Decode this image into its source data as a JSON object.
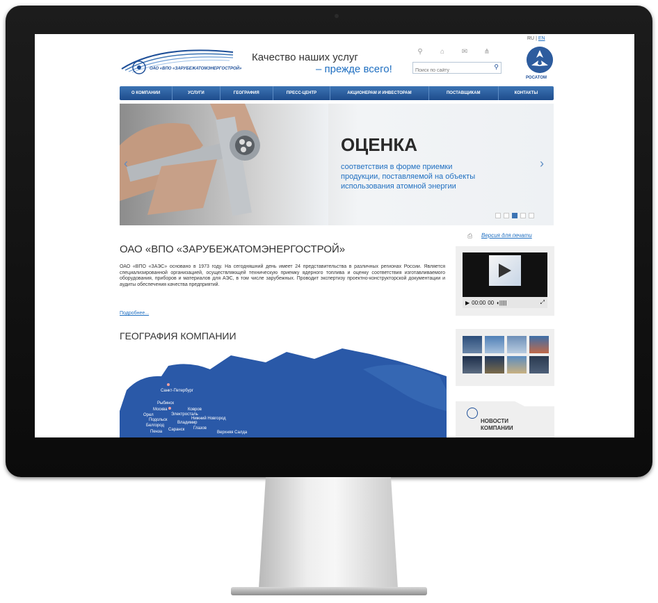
{
  "header": {
    "logo_text": "ОАО «ВПО «ЗАРУБЕЖАТОМЭНЕРГОСТРОЙ»",
    "slogan_line1": "Качество наших услуг",
    "slogan_line2": "– прежде всего!",
    "search_placeholder": "Поиск по сайту",
    "lang_ru": "RU",
    "lang_sep": " | ",
    "lang_en": "EN",
    "partner_logo_text": "РОСАТОМ",
    "icons": [
      "key-icon",
      "home-icon",
      "mail-icon",
      "sitemap-icon"
    ]
  },
  "nav": {
    "items": [
      {
        "label": "О КОМПАНИИ"
      },
      {
        "label": "УСЛУГИ"
      },
      {
        "label": "ГЕОГРАФИЯ"
      },
      {
        "label": "ПРЕСС-ЦЕНТР"
      },
      {
        "label": "АКЦИОНЕРАМ И ИНВЕСТОРАМ"
      },
      {
        "label": "ПОСТАВЩИКАМ"
      },
      {
        "label": "КОНТАКТЫ"
      }
    ]
  },
  "banner": {
    "title": "ОЦЕНКА",
    "subtitle": "соответствия в форме приемки\nпродукции, поставляемой на объекты\nиспользования атомной энергии",
    "prev": "‹",
    "next": "›",
    "slides": 5,
    "active_slide": 3
  },
  "main": {
    "print_link": "Версия для печати",
    "title": "ОАО «ВПО «ЗАРУБЕЖАТОМЭНЕРГОСТРОЙ»",
    "paragraph": "ОАО «ВПО «ЗАЭС» основано в 1973 году. На сегодняшний день имеет 24 представительства в различных регионах России. Является специализированной организацией, осуществляющей техническую приемку ядерного топлива и оценку соответствия изготавливаемого оборудования, приборов и материалов для АЭС, в том числе зарубежных. Проводит экспертизу проектно-конструкторской документации и аудиты обеспечения качества предприятий.",
    "more_link": "Подробнее...",
    "geo_title": "ГЕОГРАФИЯ КОМПАНИИ",
    "cities": [
      "Санкт-Петербург",
      "Рыбинск",
      "Москва",
      "Ковров",
      "Электросталь",
      "Орел",
      "Подольск",
      "Нижний Новгород",
      "Владимир",
      "Белгород",
      "Пенза",
      "Саранск",
      "Глазов",
      "Верхняя Салда"
    ]
  },
  "sidebar": {
    "video_time": "00:00",
    "video_duration": "00",
    "news_title": "НОВОСТИ\nКОМПАНИИ"
  },
  "colors": {
    "brand_blue": "#1e4f98",
    "link_blue": "#1f6fc1",
    "nav_gradient_top": "#3c74b4",
    "map_blue": "#2a59a8"
  }
}
